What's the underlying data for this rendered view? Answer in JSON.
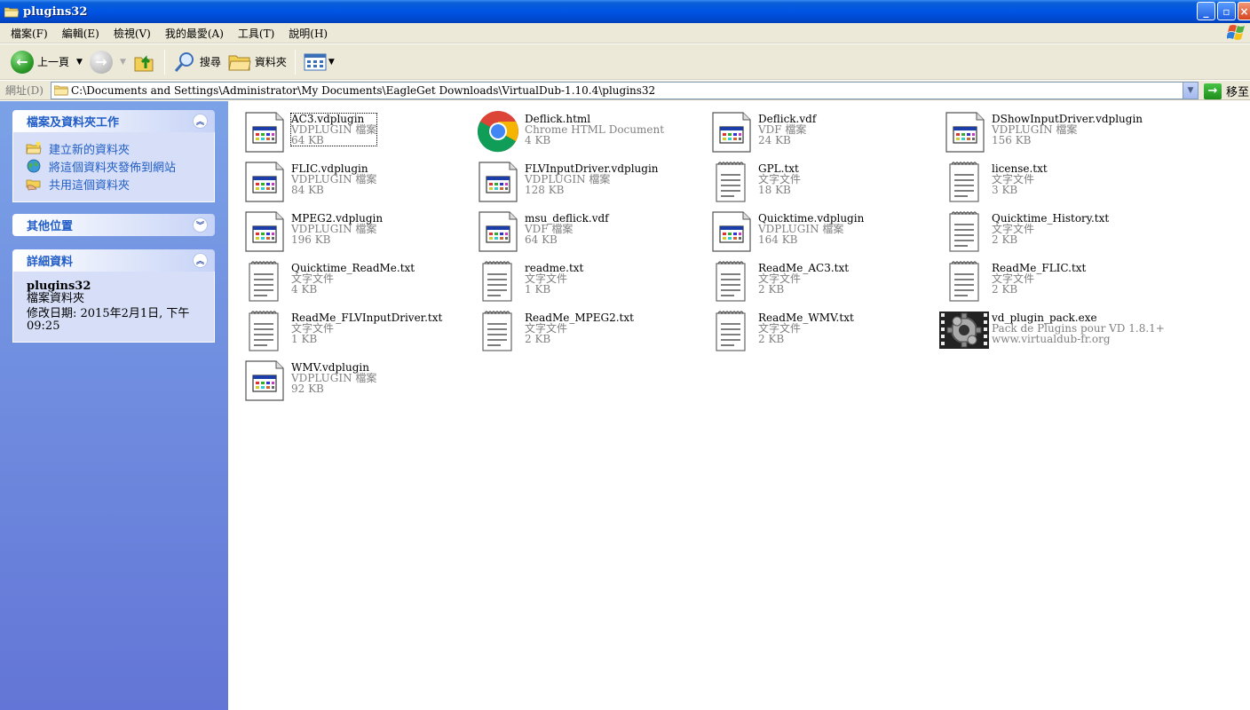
{
  "window": {
    "title": "plugins32"
  },
  "menu": [
    "檔案(F)",
    "編輯(E)",
    "檢視(V)",
    "我的最愛(A)",
    "工具(T)",
    "說明(H)"
  ],
  "toolbar": {
    "back": "上一頁",
    "search": "搜尋",
    "folders": "資料夾"
  },
  "address": {
    "label": "網址(D)",
    "path": "C:\\Documents and Settings\\Administrator\\My Documents\\EagleGet Downloads\\VirtualDub-1.10.4\\plugins32",
    "go": "移至"
  },
  "tasks": {
    "title": "檔案及資料夾工作",
    "items": [
      "建立新的資料夾",
      "將這個資料夾發佈到網站",
      "共用這個資料夾"
    ]
  },
  "other_places": {
    "title": "其他位置"
  },
  "details": {
    "title": "詳細資料",
    "name": "plugins32",
    "type": "檔案資料夾",
    "modified": "修改日期: 2015年2月1日, 下午 09:25"
  },
  "files": [
    {
      "name": "AC3.vdplugin",
      "type": "VDPLUGIN 檔案",
      "size": "64 KB",
      "icon": "vdplugin"
    },
    {
      "name": "Deflick.html",
      "type": "Chrome HTML Document",
      "size": "4 KB",
      "icon": "chrome"
    },
    {
      "name": "Deflick.vdf",
      "type": "VDF 檔案",
      "size": "24 KB",
      "icon": "vdplugin"
    },
    {
      "name": "DShowInputDriver.vdplugin",
      "type": "VDPLUGIN 檔案",
      "size": "156 KB",
      "icon": "vdplugin"
    },
    {
      "name": "FLIC.vdplugin",
      "type": "VDPLUGIN 檔案",
      "size": "84 KB",
      "icon": "vdplugin"
    },
    {
      "name": "FLVInputDriver.vdplugin",
      "type": "VDPLUGIN 檔案",
      "size": "128 KB",
      "icon": "vdplugin"
    },
    {
      "name": "GPL.txt",
      "type": "文字文件",
      "size": "18 KB",
      "icon": "txt"
    },
    {
      "name": "license.txt",
      "type": "文字文件",
      "size": "3 KB",
      "icon": "txt"
    },
    {
      "name": "MPEG2.vdplugin",
      "type": "VDPLUGIN 檔案",
      "size": "196 KB",
      "icon": "vdplugin"
    },
    {
      "name": "msu_deflick.vdf",
      "type": "VDF 檔案",
      "size": "64 KB",
      "icon": "vdplugin"
    },
    {
      "name": "Quicktime.vdplugin",
      "type": "VDPLUGIN 檔案",
      "size": "164 KB",
      "icon": "vdplugin"
    },
    {
      "name": "Quicktime_History.txt",
      "type": "文字文件",
      "size": "2 KB",
      "icon": "txt"
    },
    {
      "name": "Quicktime_ReadMe.txt",
      "type": "文字文件",
      "size": "4 KB",
      "icon": "txt"
    },
    {
      "name": "readme.txt",
      "type": "文字文件",
      "size": "1 KB",
      "icon": "txt"
    },
    {
      "name": "ReadMe_AC3.txt",
      "type": "文字文件",
      "size": "2 KB",
      "icon": "txt"
    },
    {
      "name": "ReadMe_FLIC.txt",
      "type": "文字文件",
      "size": "2 KB",
      "icon": "txt"
    },
    {
      "name": "ReadMe_FLVInputDriver.txt",
      "type": "文字文件",
      "size": "1 KB",
      "icon": "txt"
    },
    {
      "name": "ReadMe_MPEG2.txt",
      "type": "文字文件",
      "size": "2 KB",
      "icon": "txt"
    },
    {
      "name": "ReadMe_WMV.txt",
      "type": "文字文件",
      "size": "2 KB",
      "icon": "txt"
    },
    {
      "name": "vd_plugin_pack.exe",
      "type": "Pack de Plugins pour VD 1.8.1+",
      "size": "www.virtualdub-fr.org",
      "icon": "exe"
    },
    {
      "name": "WMV.vdplugin",
      "type": "VDPLUGIN 檔案",
      "size": "92 KB",
      "icon": "vdplugin"
    }
  ]
}
